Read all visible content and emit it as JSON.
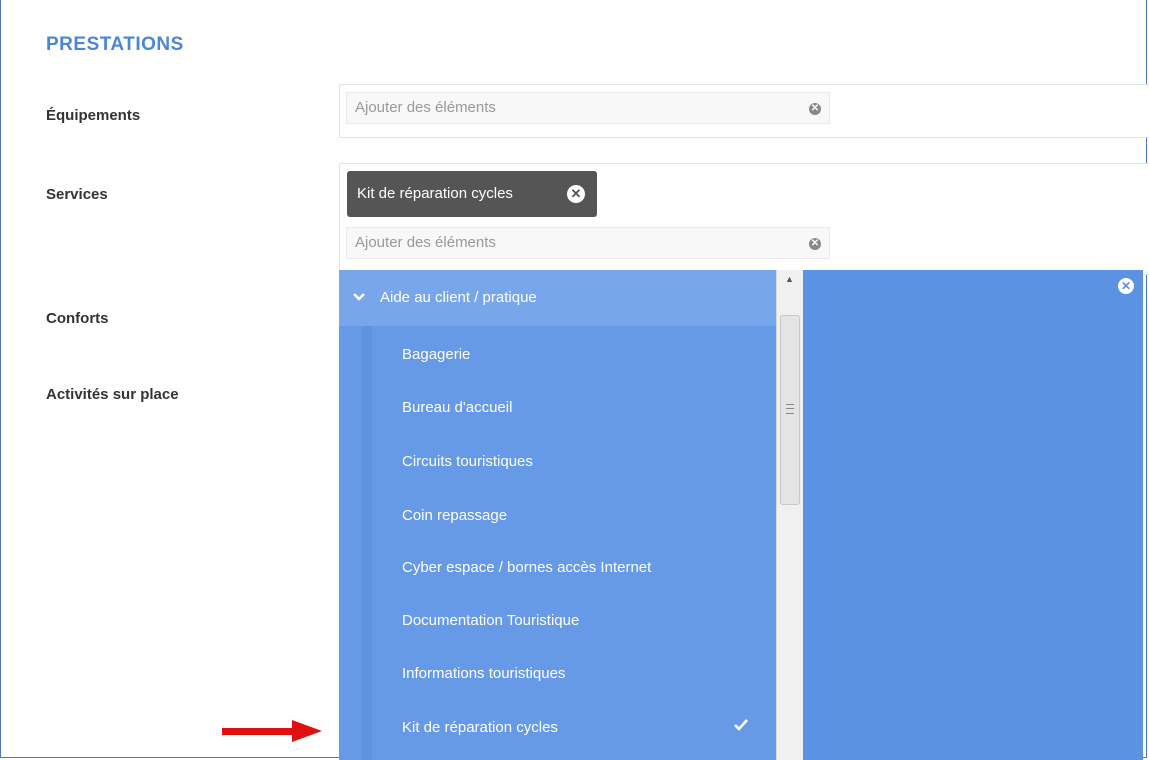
{
  "section": {
    "title": "PRESTATIONS"
  },
  "fields": {
    "equipements": {
      "label": "Équipements",
      "placeholder": "Ajouter des éléments"
    },
    "services": {
      "label": "Services",
      "selected_tag": "Kit de réparation cycles",
      "placeholder": "Ajouter des éléments"
    },
    "conforts": {
      "label": "Conforts"
    },
    "activites": {
      "label": "Activités sur place"
    }
  },
  "dropdown": {
    "group_label": "Aide au client / pratique",
    "items": [
      {
        "label": "Bagagerie",
        "checked": false
      },
      {
        "label": "Bureau d'accueil",
        "checked": false
      },
      {
        "label": "Circuits touristiques",
        "checked": false
      },
      {
        "label": "Coin repassage",
        "checked": false
      },
      {
        "label": "Cyber espace / bornes accès Internet",
        "checked": false
      },
      {
        "label": "Documentation Touristique",
        "checked": false
      },
      {
        "label": "Informations touristiques",
        "checked": false
      },
      {
        "label": "Kit de réparation cycles",
        "checked": true
      }
    ]
  },
  "icons": {
    "clear": "close-circle-icon",
    "chevron": "chevron-down-icon",
    "check": "checkmark-icon",
    "annotation": "red-arrow-icon"
  },
  "colors": {
    "accent": "#4a87d6",
    "dropdown_bg": "#6699e6",
    "dropdown_header": "#78a6ea",
    "panel_bg": "#5b92e2",
    "tag_bg": "#555555",
    "arrow": "#e01010"
  }
}
